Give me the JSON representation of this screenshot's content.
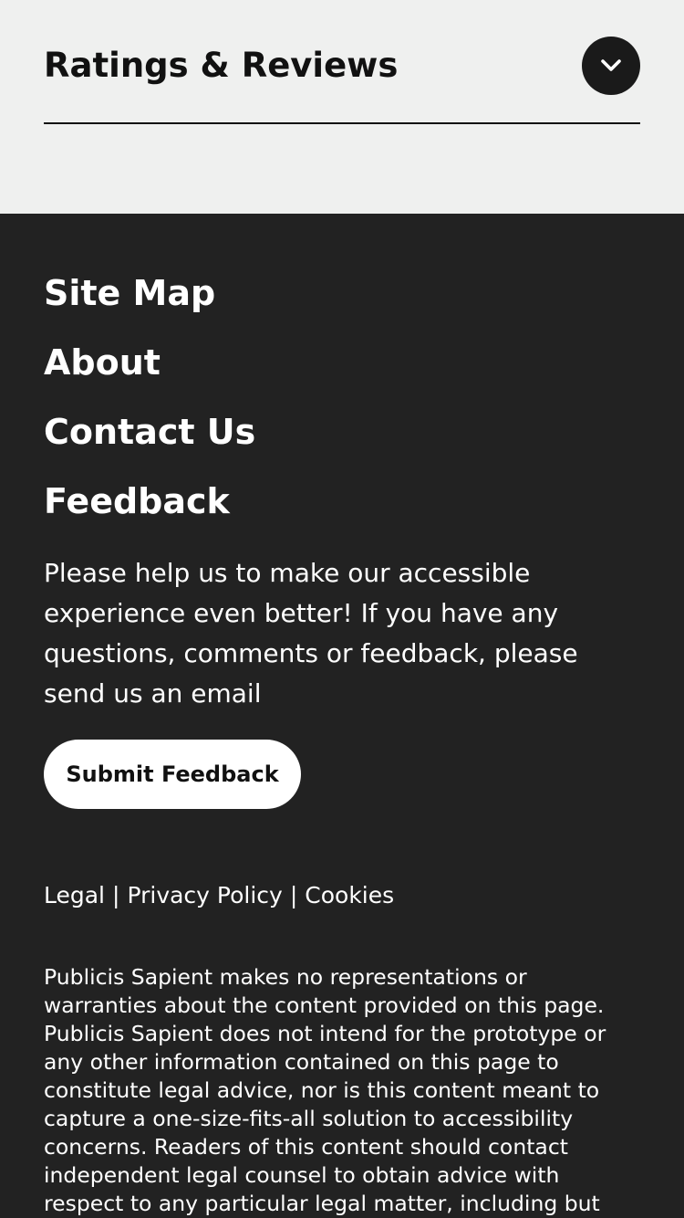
{
  "ratings": {
    "title": "Ratings & Reviews",
    "expand_icon": "chevron-down-icon"
  },
  "footer": {
    "nav": [
      {
        "label": "Site Map"
      },
      {
        "label": "About"
      },
      {
        "label": "Contact Us"
      },
      {
        "label": "Feedback"
      }
    ],
    "feedback_text": "Please help us to make our accessible experience even better! If you have any questions, comments or feedback, please send us an email",
    "submit_label": "Submit Feedback",
    "legal_links": [
      {
        "label": "Legal"
      },
      {
        "label": "Privacy Policy"
      },
      {
        "label": "Cookies"
      }
    ],
    "separator": "|",
    "disclaimer": "Publicis Sapient makes no representations or warranties about the content provided on this page. Publicis Sapient does not intend for the prototype or any other information contained on this page to constitute legal advice, nor is this content meant to capture a one-size-fits-all solution to accessibility concerns. Readers of this content should contact independent legal counsel to obtain advice with respect to any particular legal matter, including but"
  },
  "colors": {
    "ratings_background": "#eff0ef",
    "footer_background": "#222222",
    "text_dark": "#111111",
    "text_light": "#ffffff"
  }
}
